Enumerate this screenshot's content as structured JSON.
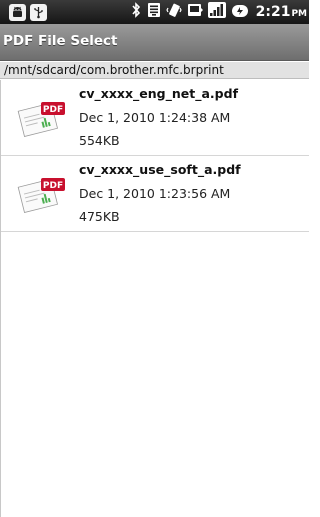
{
  "status_bar": {
    "time": "2:21",
    "ampm": "PM",
    "icons": [
      "android-icon",
      "usb-icon",
      "bluetooth-icon",
      "wifi-icon",
      "vibrate-icon",
      "sdcard-icon",
      "signal-icon",
      "battery-charging-icon"
    ]
  },
  "title": "PDF File Select",
  "path": "/mnt/sdcard/com.brother.mfc.brprint",
  "files": [
    {
      "name": "cv_xxxx_eng_net_a.pdf",
      "date": "Dec 1, 2010 1:24:38 AM",
      "size": "554KB"
    },
    {
      "name": "cv_xxxx_use_soft_a.pdf",
      "date": "Dec 1, 2010 1:23:56 AM",
      "size": "475KB"
    }
  ],
  "colors": {
    "title_bar": "#858585",
    "path_bar": "#e2e2e2",
    "pdf_badge": "#c8102e"
  }
}
